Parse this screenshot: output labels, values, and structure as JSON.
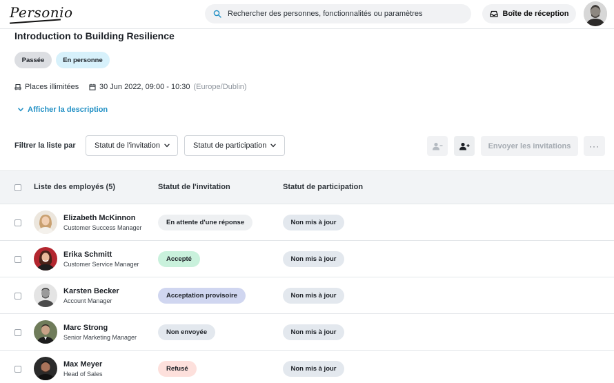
{
  "app": {
    "logo_text": "Personio",
    "search_placeholder": "Rechercher des personnes, fonctionnalités ou paramètres",
    "inbox_label": "Boîte de réception"
  },
  "event": {
    "title": "Introduction to Building Resilience",
    "tags": [
      {
        "label": "Passée",
        "color": "#dcdee2"
      },
      {
        "label": "En personne",
        "color": "#d7f1fb"
      }
    ],
    "places": "Places illimitées",
    "date": "30 Jun 2022, 09:00 - 10:30",
    "timezone": "(Europe/Dublin)",
    "description_link": "Afficher la description"
  },
  "filters": {
    "label": "Filtrer la liste par",
    "invitation_dropdown": "Statut de l'invitation",
    "participation_dropdown": "Statut de participation",
    "send_button": "Envoyer les invitations",
    "more_button": "···"
  },
  "table": {
    "headers": {
      "employees": "Liste des employés (5)",
      "invitation": "Statut de l'invitation",
      "participation": "Statut de participation"
    },
    "rows": [
      {
        "name": "Elizabeth McKinnon",
        "role": "Customer Success Manager",
        "invitation": "En attente d'une réponse",
        "invitation_color": "#eef0f2",
        "participation": "Non mis à jour"
      },
      {
        "name": "Erika Schmitt",
        "role": "Customer Service Manager",
        "invitation": "Accepté",
        "invitation_color": "#c9f1dc",
        "participation": "Non mis à jour"
      },
      {
        "name": "Karsten Becker",
        "role": "Account Manager",
        "invitation": "Acceptation provisoire",
        "invitation_color": "#d0d6f0",
        "participation": "Non mis à jour"
      },
      {
        "name": "Marc Strong",
        "role": "Senior Marketing Manager",
        "invitation": "Non envoyée",
        "invitation_color": "#e3e8ee",
        "participation": "Non mis à jour"
      },
      {
        "name": "Max Meyer",
        "role": "Head of Sales",
        "invitation": "Refusé",
        "invitation_color": "#fde0dc",
        "participation": "Non mis à jour"
      }
    ]
  },
  "colors": {
    "accent": "#1f8fc4",
    "participation_pill": "#e3e8ee"
  }
}
